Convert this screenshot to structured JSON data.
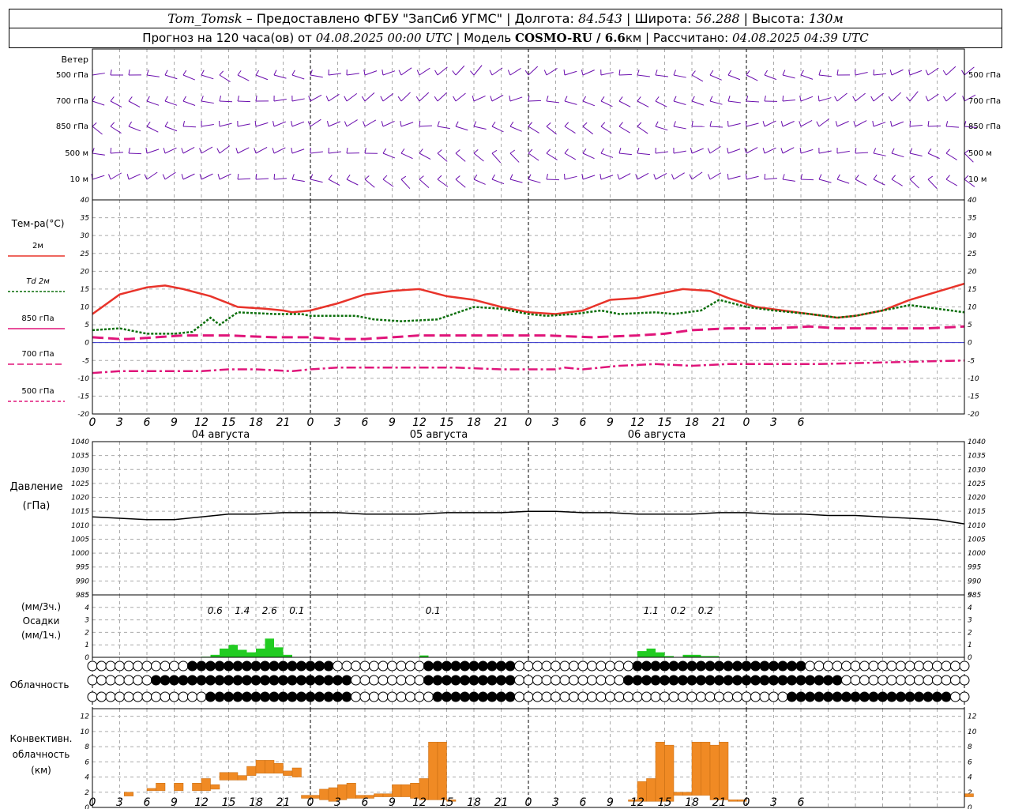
{
  "header": {
    "station": "Tom_Tomsk",
    "provider": "– Предоставлено ФГБУ \"ЗапСиб УГМС\" | Долгота:",
    "lon": "84.543",
    "lat_label": "| Широта:",
    "lat": "56.288",
    "alt_label": "| Высота:",
    "alt": "130м",
    "forecast_label": "Прогноз на 120 часа(ов) от",
    "forecast_start": "04.08.2025 00:00 UTC",
    "model_label": "| Модель",
    "model": "COSMO-RU / 6.6",
    "model_unit": "км",
    "calc_label": "| Рассчитано:",
    "calc_time": "04.08.2025 04:39 UTC"
  },
  "panels": {
    "wind": {
      "title": "Ветер",
      "levels": [
        "500 гПа",
        "700 гПа",
        "850 гПа",
        "500 м",
        "10 м"
      ]
    },
    "temp": {
      "title": "Тем-ра(°C)",
      "legend": [
        "2м",
        "Td 2м",
        "850 гПа",
        "700 гПа",
        "500 гПа"
      ]
    },
    "pressure": {
      "title": "Давление",
      "unit": "(гПа)"
    },
    "precip": {
      "unit_3h": "(мм/3ч.)",
      "title": "Осадки",
      "unit_1h": "(мм/1ч.)"
    },
    "cloud": {
      "title": "Облачность"
    },
    "conv": {
      "title": [
        "Конвективн.",
        "облачность",
        "(км)"
      ]
    }
  },
  "x_axis": {
    "ticks": [
      "0",
      "3",
      "6",
      "9",
      "12",
      "15",
      "18",
      "21",
      "0",
      "3",
      "6",
      "9",
      "12",
      "15",
      "18",
      "21",
      "0",
      "3",
      "6",
      "9",
      "12",
      "15",
      "18",
      "21",
      "0",
      "3",
      "6"
    ],
    "dates": [
      "04 августа",
      "05 августа",
      "06 августа"
    ]
  },
  "colors": {
    "t2m": "#e8332a",
    "td2m": "#0a6e0a",
    "t850": "#e0157a",
    "wind": "#6a0dad",
    "precip": "#22cc22",
    "conv": "#f08a24",
    "zero": "#3333cc"
  },
  "chart_data": [
    {
      "type": "line",
      "title": "Тем-ра(°C)",
      "x_hours": [
        0,
        6,
        12,
        18,
        24,
        30,
        36,
        42,
        48,
        54,
        60,
        66,
        72,
        78,
        84,
        90,
        96,
        102,
        108,
        114,
        120,
        126,
        132,
        138,
        144,
        150
      ],
      "ylim": [
        -20,
        40
      ],
      "yticks": [
        -20,
        -15,
        -10,
        -5,
        0,
        5,
        10,
        15,
        20,
        25,
        30,
        35,
        40
      ],
      "series": [
        {
          "name": "2м",
          "values": [
            8,
            13.5,
            15.5,
            16,
            15,
            13,
            10,
            9.5,
            9,
            8.5,
            9,
            11,
            13.5,
            14.5,
            15,
            13,
            12,
            10,
            8.5,
            8,
            9,
            12,
            12.5,
            14,
            15,
            14.5,
            12.5,
            10,
            9,
            8,
            7,
            7.5,
            9,
            12,
            16.5
          ],
          "hours": [
            0,
            3,
            6,
            8,
            10,
            13,
            16,
            19,
            21,
            22,
            24,
            27,
            30,
            33,
            36,
            39,
            42,
            45,
            48,
            51,
            54,
            57,
            60,
            63,
            65,
            68,
            70,
            73,
            76,
            79,
            82,
            84,
            87,
            90,
            96
          ]
        },
        {
          "name": "Td 2м",
          "values": [
            3.5,
            4,
            2.5,
            2.5,
            3,
            7,
            5,
            8.5,
            8,
            8,
            7.5,
            7.5,
            6.5,
            6,
            6.5,
            10,
            9.5,
            8,
            7.5,
            8,
            9,
            8,
            8.5,
            8,
            9,
            12,
            10,
            9,
            8,
            7,
            7.5,
            9,
            10.5,
            8.5
          ],
          "hours": [
            0,
            3,
            6,
            9,
            11,
            13,
            14,
            16,
            20,
            23,
            24,
            29,
            31,
            34,
            38,
            42,
            45,
            48,
            50,
            53,
            56,
            58,
            62,
            64,
            67,
            69,
            72,
            75,
            79,
            82,
            84,
            87,
            90,
            96
          ]
        },
        {
          "name": "850 гПа",
          "values": [
            1.5,
            1,
            1,
            1.5,
            2,
            2,
            1.5,
            1.5,
            1,
            1,
            1.5,
            2,
            2,
            2,
            2,
            1.5,
            2,
            2.5,
            3.5,
            4,
            4,
            4.5,
            4,
            4,
            4,
            4,
            4,
            4.5
          ],
          "hours": [
            0,
            3,
            4,
            7,
            10,
            15,
            20,
            24,
            27,
            30,
            33,
            36,
            40,
            45,
            50,
            55,
            60,
            63,
            66,
            70,
            75,
            79,
            82,
            86,
            88,
            90,
            92,
            96
          ]
        },
        {
          "name": "700 гПа",
          "values": [
            -8.5,
            -8,
            -8,
            -8,
            -8,
            -7.5,
            -7.5,
            -8,
            -7.5,
            -7,
            -7,
            -7,
            -7,
            -7,
            -7.5,
            -7.5,
            -7.5,
            -7,
            -7.5,
            -6.5,
            -6,
            -6.5,
            -6,
            -6,
            -6,
            -5.5,
            -5
          ],
          "hours": [
            0,
            3,
            6,
            9,
            12,
            15,
            18,
            22,
            24,
            27,
            30,
            33,
            36,
            40,
            45,
            48,
            51,
            52,
            54,
            58,
            62,
            66,
            70,
            75,
            80,
            88,
            96
          ]
        }
      ]
    },
    {
      "type": "line",
      "title": "Давление",
      "ylim": [
        985,
        1040
      ],
      "yticks": [
        985,
        990,
        995,
        1000,
        1005,
        1010,
        1015,
        1020,
        1025,
        1030,
        1035,
        1040
      ],
      "hours": [
        0,
        3,
        6,
        9,
        12,
        15,
        18,
        21,
        24,
        27,
        30,
        33,
        36,
        39,
        42,
        45,
        48,
        51,
        54,
        57,
        60,
        63,
        66,
        69,
        72,
        75,
        78,
        81,
        84,
        87,
        90,
        93,
        96
      ],
      "values": [
        1013,
        1012.5,
        1012,
        1012,
        1013,
        1014,
        1014,
        1014.5,
        1014.5,
        1014.5,
        1014,
        1014,
        1014,
        1014.5,
        1014.5,
        1014.5,
        1015,
        1015,
        1014.5,
        1014.5,
        1014,
        1014,
        1014,
        1014.5,
        1014.5,
        1014,
        1014,
        1013.5,
        1013.5,
        1013,
        1012.5,
        1012,
        1010.5
      ]
    },
    {
      "type": "bar",
      "title": "Осадки",
      "ylim": [
        0,
        5
      ],
      "yticks": [
        0,
        1,
        2,
        3,
        4,
        5
      ],
      "sums_3h": [
        {
          "hour": 13.5,
          "label": "0.6"
        },
        {
          "hour": 16.5,
          "label": "1.4"
        },
        {
          "hour": 19.5,
          "label": "2.6"
        },
        {
          "hour": 22.5,
          "label": "0.1"
        },
        {
          "hour": 37.5,
          "label": "0.1"
        },
        {
          "hour": 61.5,
          "label": "1.1"
        },
        {
          "hour": 64.5,
          "label": "0.2"
        },
        {
          "hour": 67.5,
          "label": "0.2"
        }
      ],
      "hourly": [
        {
          "h": 12,
          "v": 0.05
        },
        {
          "h": 13,
          "v": 0.2
        },
        {
          "h": 14,
          "v": 0.7
        },
        {
          "h": 15,
          "v": 1.0
        },
        {
          "h": 16,
          "v": 0.6
        },
        {
          "h": 17,
          "v": 0.4
        },
        {
          "h": 18,
          "v": 0.7
        },
        {
          "h": 19,
          "v": 1.5
        },
        {
          "h": 20,
          "v": 0.8
        },
        {
          "h": 21,
          "v": 0.2
        },
        {
          "h": 36,
          "v": 0.15
        },
        {
          "h": 60,
          "v": 0.5
        },
        {
          "h": 61,
          "v": 0.7
        },
        {
          "h": 62,
          "v": 0.4
        },
        {
          "h": 63,
          "v": 0.1
        },
        {
          "h": 65,
          "v": 0.2
        },
        {
          "h": 66,
          "v": 0.2
        },
        {
          "h": 67,
          "v": 0.1
        },
        {
          "h": 68,
          "v": 0.1
        }
      ]
    },
    {
      "type": "bar",
      "title": "Конвективн. облачность (км)",
      "ylim": [
        0,
        13
      ],
      "yticks": [
        0,
        2,
        4,
        6,
        8,
        10,
        12
      ],
      "bars": [
        {
          "h": 3.5,
          "v": [
            1.5,
            2
          ]
        },
        {
          "h": 6,
          "v": [
            2.2,
            2.5
          ]
        },
        {
          "h": 7,
          "v": [
            2.2,
            3.2
          ]
        },
        {
          "h": 9,
          "v": [
            2.2,
            3.2
          ]
        },
        {
          "h": 11,
          "v": [
            2.2,
            3.2
          ]
        },
        {
          "h": 12,
          "v": [
            2.2,
            3.8
          ]
        },
        {
          "h": 13,
          "v": [
            2.4,
            3
          ]
        },
        {
          "h": 14,
          "v": [
            3.6,
            4.6
          ]
        },
        {
          "h": 15,
          "v": [
            3.6,
            4.6
          ]
        },
        {
          "h": 16,
          "v": [
            3.6,
            4.2
          ]
        },
        {
          "h": 17,
          "v": [
            4.2,
            5.4
          ]
        },
        {
          "h": 18,
          "v": [
            4.5,
            6.2
          ]
        },
        {
          "h": 19,
          "v": [
            4.5,
            6.2
          ]
        },
        {
          "h": 20,
          "v": [
            4.5,
            5.8
          ]
        },
        {
          "h": 21,
          "v": [
            4.2,
            4.8
          ]
        },
        {
          "h": 22,
          "v": [
            4,
            5.2
          ]
        },
        {
          "h": 23,
          "v": [
            1.2,
            1.6
          ]
        },
        {
          "h": 24,
          "v": [
            1.2,
            1.6
          ]
        },
        {
          "h": 25,
          "v": [
            1,
            2.4
          ]
        },
        {
          "h": 26,
          "v": [
            0.8,
            2.6
          ]
        },
        {
          "h": 27,
          "v": [
            1,
            3
          ]
        },
        {
          "h": 28,
          "v": [
            1.2,
            3.2
          ]
        },
        {
          "h": 29,
          "v": [
            1.2,
            1.6
          ]
        },
        {
          "h": 30,
          "v": [
            1.2,
            1.6
          ]
        },
        {
          "h": 31,
          "v": [
            1.4,
            1.8
          ]
        },
        {
          "h": 32,
          "v": [
            1.4,
            1.8
          ]
        },
        {
          "h": 33,
          "v": [
            1.4,
            3
          ]
        },
        {
          "h": 34,
          "v": [
            1.4,
            3
          ]
        },
        {
          "h": 35,
          "v": [
            1.2,
            3.2
          ]
        },
        {
          "h": 36,
          "v": [
            1,
            3.8
          ]
        },
        {
          "h": 37,
          "v": [
            1,
            8.6
          ]
        },
        {
          "h": 38,
          "v": [
            1,
            8.6
          ]
        },
        {
          "h": 39,
          "v": [
            0.8,
            1
          ]
        },
        {
          "h": 59,
          "v": [
            0.8,
            1
          ]
        },
        {
          "h": 60,
          "v": [
            0.8,
            3.4
          ]
        },
        {
          "h": 61,
          "v": [
            0.8,
            3.8
          ]
        },
        {
          "h": 62,
          "v": [
            0.8,
            8.6
          ]
        },
        {
          "h": 63,
          "v": [
            0.8,
            8.2
          ]
        },
        {
          "h": 64,
          "v": [
            1.6,
            2
          ]
        },
        {
          "h": 65,
          "v": [
            1.6,
            2
          ]
        },
        {
          "h": 66,
          "v": [
            1.6,
            8.6
          ]
        },
        {
          "h": 67,
          "v": [
            1.6,
            8.6
          ]
        },
        {
          "h": 68,
          "v": [
            1,
            8.2
          ]
        },
        {
          "h": 69,
          "v": [
            1,
            8.6
          ]
        },
        {
          "h": 70,
          "v": [
            0.8,
            1
          ]
        },
        {
          "h": 71,
          "v": [
            0.8,
            1
          ]
        },
        {
          "h": 96,
          "v": [
            1.4,
            1.8
          ]
        }
      ]
    }
  ]
}
